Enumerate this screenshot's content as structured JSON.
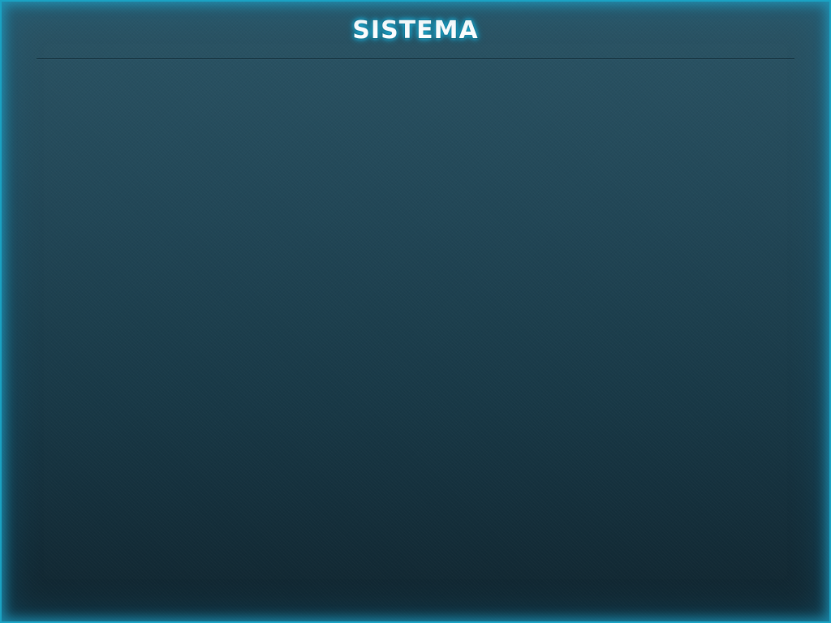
{
  "header": {
    "title": "SISTEMA"
  },
  "colors": {
    "frame_glow": "#1aa3c4",
    "background_top": "#2b5566",
    "background_bottom": "#10252f",
    "title_text": "#ffffff"
  }
}
